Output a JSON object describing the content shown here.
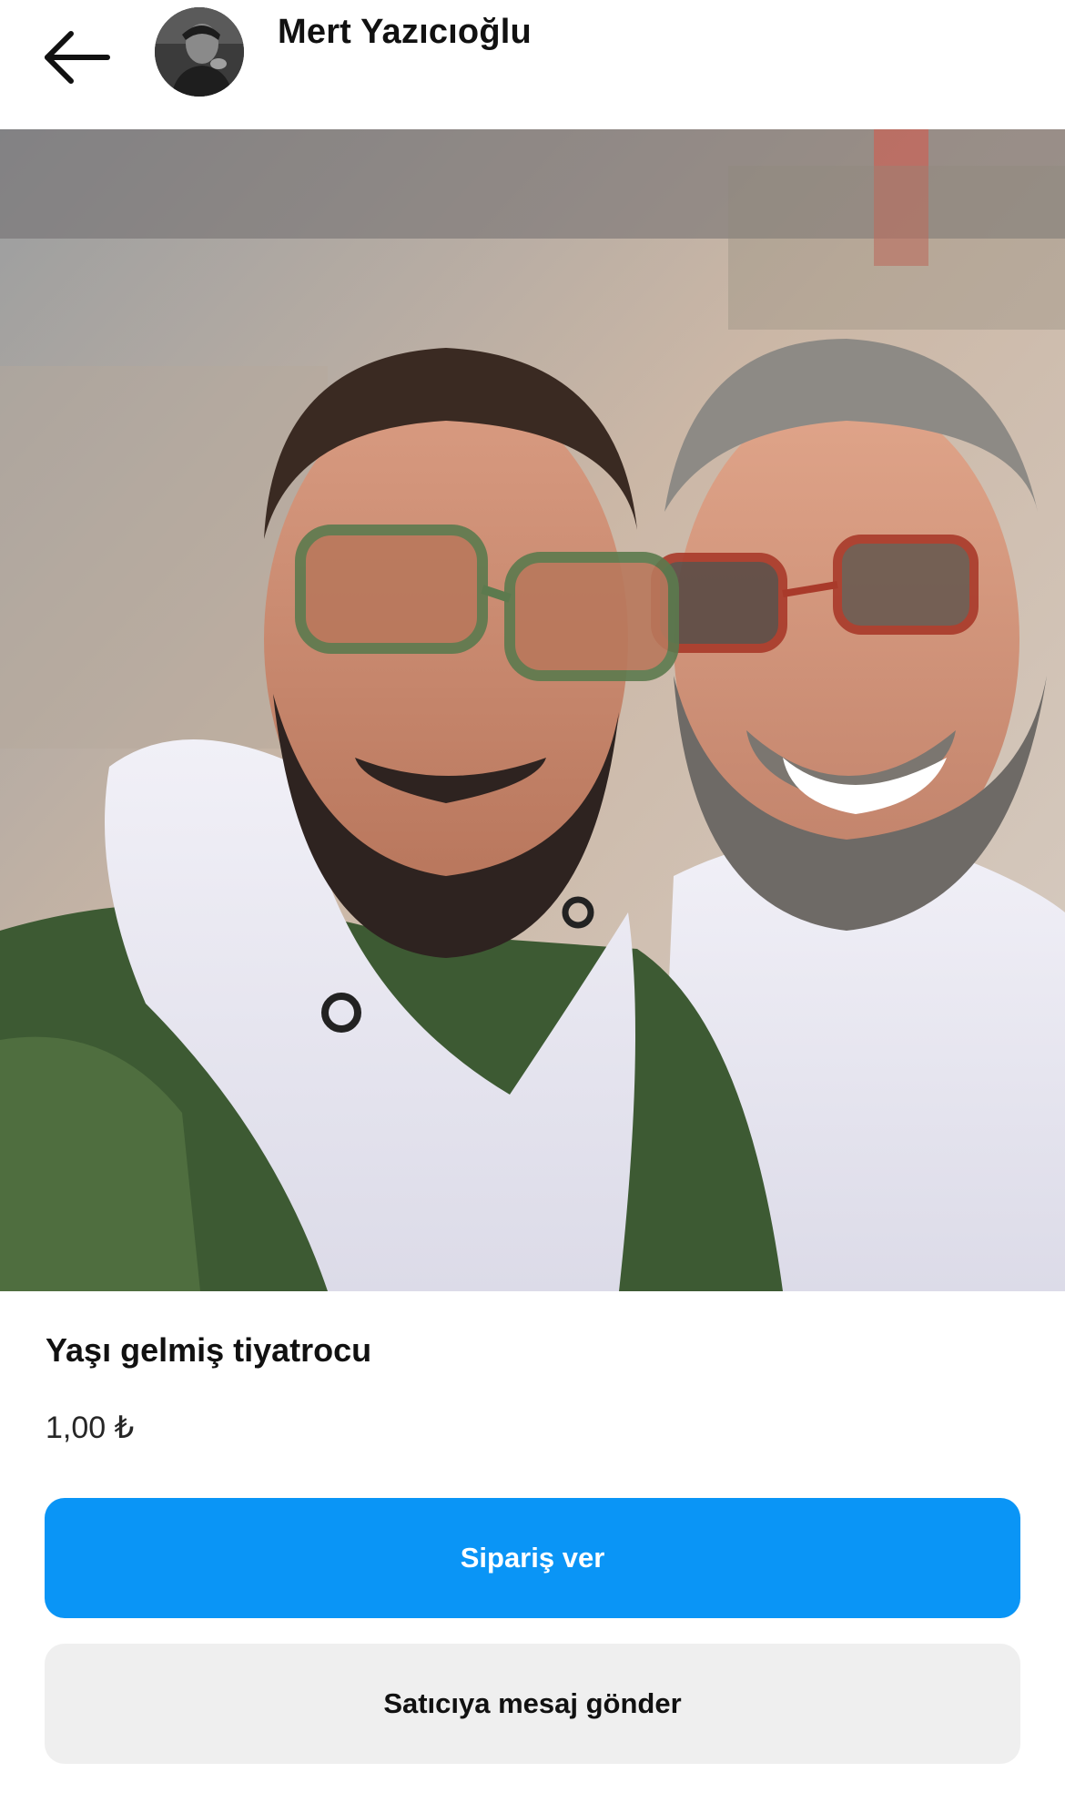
{
  "header": {
    "back_icon": "arrow-left-icon",
    "seller_name": "Mert Yazıcıoğlu",
    "avatar": "seller-avatar"
  },
  "product": {
    "title": "Yaşı gelmiş tiyatrocu",
    "price": "1,00 ₺"
  },
  "actions": {
    "order_label": "Sipariş ver",
    "message_label": "Satıcıya mesaj gönder"
  },
  "colors": {
    "primary_button": "#0a95f6",
    "secondary_button": "#efefef"
  }
}
